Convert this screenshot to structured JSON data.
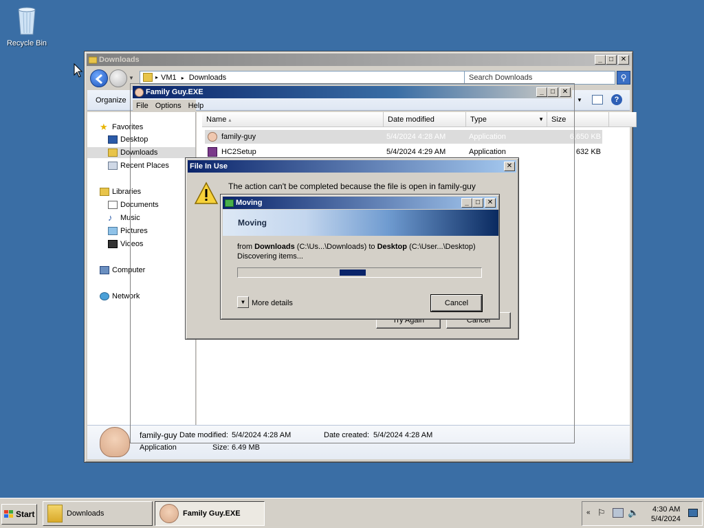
{
  "desktop": {
    "recycle_bin_label": "Recycle Bin"
  },
  "explorer": {
    "title": "Downloads",
    "breadcrumb": [
      "VM1",
      "Downloads"
    ],
    "search_placeholder": "Search Downloads",
    "toolbar": {
      "organize": "Organize"
    },
    "nav": {
      "favorites": "Favorites",
      "desktop": "Desktop",
      "downloads": "Downloads",
      "recent": "Recent Places",
      "libraries": "Libraries",
      "documents": "Documents",
      "music": "Music",
      "pictures": "Pictures",
      "videos": "Videos",
      "computer": "Computer",
      "network": "Network"
    },
    "columns": {
      "name": "Name",
      "date": "Date modified",
      "type": "Type",
      "size": "Size"
    },
    "files": [
      {
        "name": "family-guy",
        "date": "5/4/2024 4:28 AM",
        "type": "Application",
        "size": "6,650 KB"
      },
      {
        "name": "HC2Setup",
        "date": "5/4/2024 4:29 AM",
        "type": "Application",
        "size": "632 KB"
      }
    ],
    "details": {
      "name": "family-guy",
      "date_modified_label": "Date modified:",
      "date_modified": "5/4/2024 4:28 AM",
      "date_created_label": "Date created:",
      "date_created": "5/4/2024 4:28 AM",
      "type": "Application",
      "size_label": "Size:",
      "size": "6.49 MB"
    }
  },
  "family_guy_window": {
    "title": "Family Guy.EXE",
    "menu": [
      "File",
      "Options",
      "Help"
    ]
  },
  "file_in_use": {
    "title": "File In Use",
    "message": "The action can't be completed because the file is open in family-guy",
    "try_again": "Try Again",
    "cancel": "Cancel"
  },
  "moving": {
    "title": "Moving",
    "header": "Moving",
    "from_word": "from",
    "src_name": "Downloads",
    "src_path": "(C:\\Us...\\Downloads)",
    "to_word": "to",
    "dst_name": "Desktop",
    "dst_path": "(C:\\User...\\Desktop)",
    "status": "Discovering items...",
    "progress_state": "marquee",
    "more_details": "More details",
    "cancel": "Cancel"
  },
  "taskbar": {
    "start": "Start",
    "tasks": [
      {
        "label": "Downloads",
        "active": false
      },
      {
        "label": "Family Guy.EXE",
        "active": true
      }
    ],
    "time": "4:30 AM",
    "date": "5/4/2024"
  },
  "colors": {
    "desktop": "#3a6ea5",
    "title_active": "#0a246a",
    "selection": "#dcdcdc",
    "progress": "#0a246a"
  }
}
